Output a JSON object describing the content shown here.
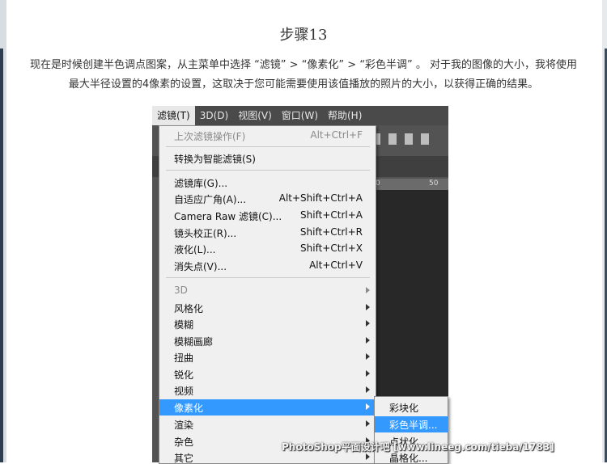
{
  "article": {
    "title": "步骤13",
    "paragraph_line1": "现在是时候创建半色调点图案，从主菜单中选择 “滤镜” > “像素化” > “彩色半调” 。 对于我的图像的大小，我将使用",
    "paragraph_line2": "最大半径设置的4像素的设置，这取决于您可能需要使用该值播放的照片的大小，以获得正确的结果。"
  },
  "photoshop": {
    "menubar": [
      "滤镜(T)",
      "3D(D)",
      "视图(V)",
      "窗口(W)",
      "帮助(H)"
    ],
    "ruler_labels": [
      "0",
      "50"
    ]
  },
  "filter_menu": {
    "items": [
      {
        "label": "上次滤镜操作(F)",
        "shortcut": "Alt+Ctrl+F",
        "disabled": true
      },
      {
        "label": "转换为智能滤镜(S)"
      },
      {
        "label": "滤镜库(G)..."
      },
      {
        "label": "自适应广角(A)...",
        "shortcut": "Alt+Shift+Ctrl+A"
      },
      {
        "label": "Camera Raw 滤镜(C)...",
        "shortcut": "Shift+Ctrl+A"
      },
      {
        "label": "镜头校正(R)...",
        "shortcut": "Shift+Ctrl+R"
      },
      {
        "label": "液化(L)...",
        "shortcut": "Shift+Ctrl+X"
      },
      {
        "label": "消失点(V)...",
        "shortcut": "Alt+Ctrl+V"
      },
      {
        "label": "3D",
        "submenu": true,
        "disabled": true
      },
      {
        "label": "风格化",
        "submenu": true
      },
      {
        "label": "模糊",
        "submenu": true
      },
      {
        "label": "模糊画廊",
        "submenu": true
      },
      {
        "label": "扭曲",
        "submenu": true
      },
      {
        "label": "锐化",
        "submenu": true
      },
      {
        "label": "视频",
        "submenu": true
      },
      {
        "label": "像素化",
        "submenu": true,
        "highlighted": true
      },
      {
        "label": "渲染",
        "submenu": true
      },
      {
        "label": "杂色",
        "submenu": true
      },
      {
        "label": "其它",
        "submenu": true
      }
    ]
  },
  "pixelate_submenu": {
    "items": [
      {
        "label": "彩块化"
      },
      {
        "label": "彩色半调...",
        "highlighted": true
      },
      {
        "label": "点状化..."
      },
      {
        "label": "晶格化..."
      }
    ]
  },
  "watermark": "PhotoShop平面设计吧 [www.lineeg.com/tieba/1783]",
  "colors": {
    "highlight": "#3399ff",
    "menu_bg": "#f0f0f0",
    "ps_bg": "#535353"
  }
}
